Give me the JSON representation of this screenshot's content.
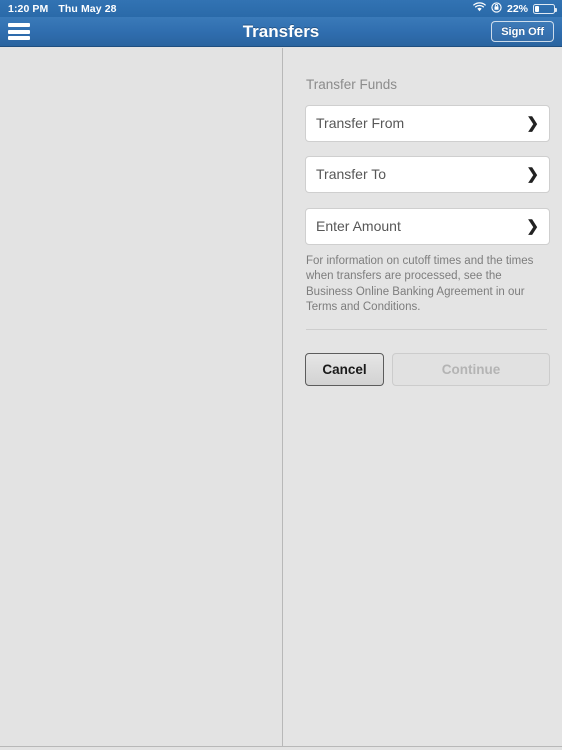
{
  "status_bar": {
    "time": "1:20 PM",
    "date": "Thu May 28",
    "battery_percent": "22%",
    "wifi_icon": "wifi-icon",
    "rotation_lock_icon": "rotation-lock-icon",
    "battery_icon": "battery-icon"
  },
  "nav_bar": {
    "menu_icon": "hamburger-menu-icon",
    "title": "Transfers",
    "sign_off_label": "Sign Off",
    "accent_color": "#2f6dae"
  },
  "form": {
    "section_title": "Transfer Funds",
    "fields": [
      {
        "label": "Transfer From",
        "chevron": "❯",
        "icon": "chevron-right-icon"
      },
      {
        "label": "Transfer To",
        "chevron": "❯",
        "icon": "chevron-right-icon"
      },
      {
        "label": "Enter Amount",
        "chevron": "❯",
        "icon": "chevron-right-icon"
      }
    ],
    "disclaimer": "For information on cutoff times and the times when transfers are processed, see the Business Online Banking Agreement in our Terms and Conditions."
  },
  "actions": {
    "cancel_label": "Cancel",
    "continue_label": "Continue",
    "continue_enabled": false
  }
}
